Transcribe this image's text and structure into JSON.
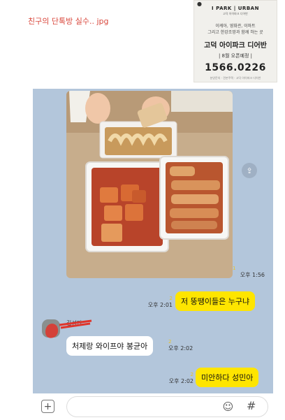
{
  "post": {
    "title": "친구의 단톡방 실수.. jpg"
  },
  "ad": {
    "brand": "I PARK | URBAN",
    "brand_sub": "고덕 아이파크 디어반",
    "line1": "이케아, 영화관, 이마트",
    "line2": "그리고 한강조망과 함께 하는 곳",
    "headline": "고덕 아이파크 디어반",
    "open": "| 8월 오픈예정 |",
    "phone": "1566.0226",
    "tiny": "분양문의 · 견본주택 · 고덕 아이파크 디어반"
  },
  "chat": {
    "background_color": "#b3c6db",
    "image_message": {
      "unread": "1",
      "time": "오후 1:56"
    },
    "messages": [
      {
        "from": "me",
        "text": "저 뚱땡이들은 누구냐",
        "unread": "2",
        "time": "오후 2:01"
      },
      {
        "from": "other",
        "sender": "김성민",
        "text": "처제랑 와이프야 봉균아",
        "unread": "2",
        "time": "오후 2:02"
      },
      {
        "from": "me",
        "text": "미안하다 성민아",
        "unread": "2",
        "time": "오후 2:02"
      }
    ],
    "input": {
      "placeholder": ""
    },
    "icons": {
      "attach": "plus-icon",
      "emoji": "emoji-icon",
      "hash": "hash-icon",
      "share": "share-icon"
    }
  }
}
